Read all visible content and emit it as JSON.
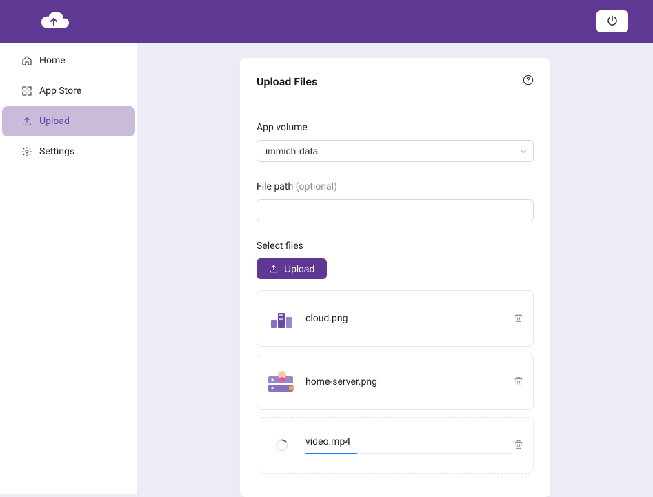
{
  "accent_color": "#5f3894",
  "sidebar": {
    "items": [
      {
        "label": "Home",
        "icon": "home"
      },
      {
        "label": "App Store",
        "icon": "grid"
      },
      {
        "label": "Upload",
        "icon": "upload"
      },
      {
        "label": "Settings",
        "icon": "gear"
      }
    ],
    "active_index": 2
  },
  "card": {
    "title": "Upload Files"
  },
  "form": {
    "volume_label": "App volume",
    "volume_value": "immich-data",
    "path_label": "File path",
    "path_optional": "(optional)",
    "path_value": "",
    "select_files_label": "Select files",
    "upload_button": "Upload"
  },
  "files": [
    {
      "name": "cloud.png",
      "status": "done"
    },
    {
      "name": "home-server.png",
      "status": "done"
    },
    {
      "name": "video.mp4",
      "status": "uploading",
      "progress": 25
    }
  ]
}
